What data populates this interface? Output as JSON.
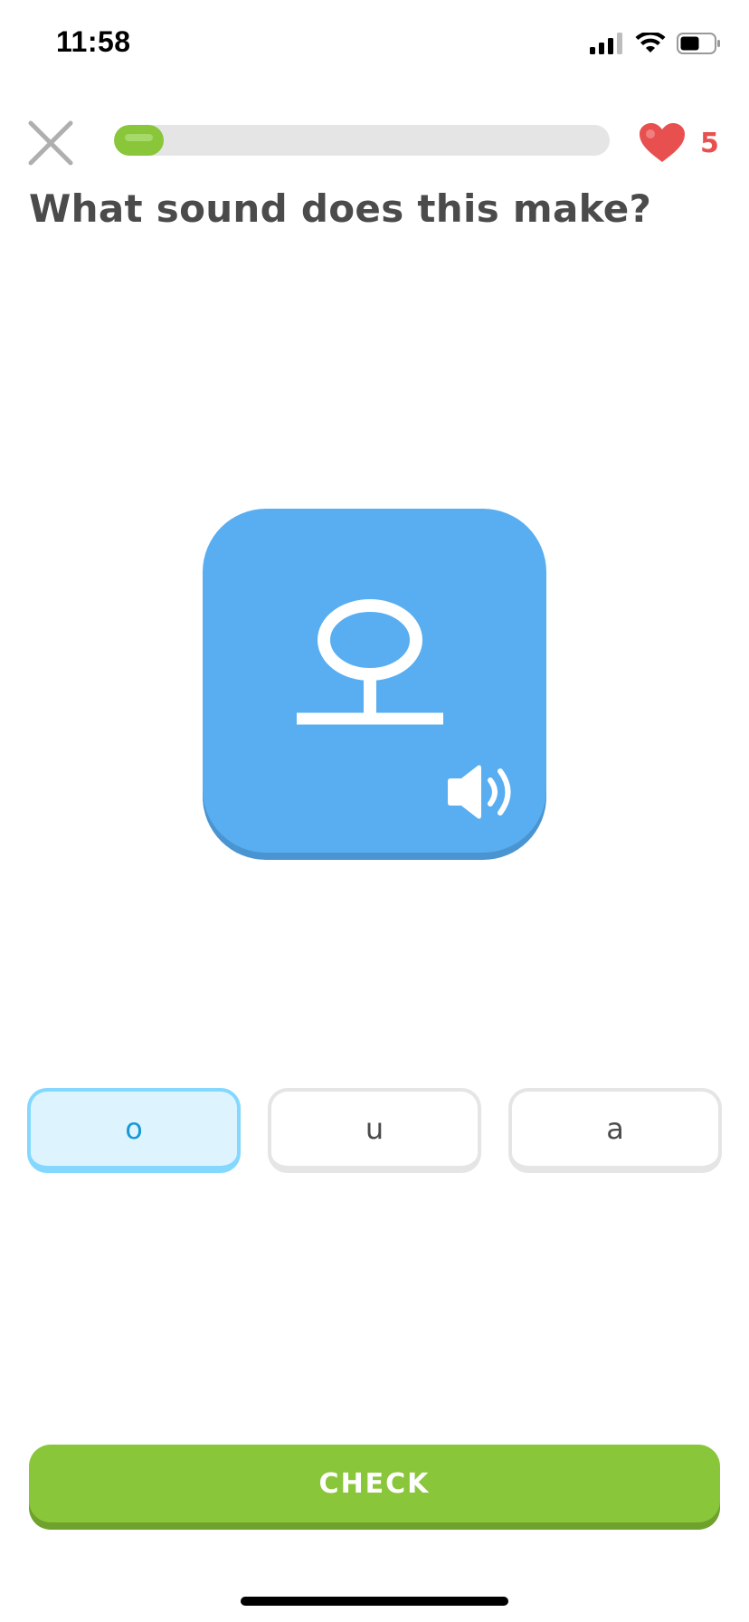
{
  "status_bar": {
    "time": "11:58",
    "icons": [
      "cellular-signal-icon",
      "wifi-icon",
      "battery-icon"
    ]
  },
  "header": {
    "close_icon": "close-icon",
    "progress": 0.1,
    "hearts": {
      "icon": "heart-icon",
      "count": "5"
    }
  },
  "question": {
    "text": "What sound does this make?"
  },
  "character_card": {
    "character": "ㅗ",
    "audio_icon": "speaker-icon"
  },
  "options": [
    {
      "label": "o",
      "selected": true
    },
    {
      "label": "u",
      "selected": false
    },
    {
      "label": "a",
      "selected": false
    }
  ],
  "check_button": {
    "label": "CHECK"
  },
  "colors": {
    "accent_green": "#89c63a",
    "card_blue": "#58aef0",
    "heart_red": "#e8504f",
    "selected_blue": "#84d8ff"
  }
}
